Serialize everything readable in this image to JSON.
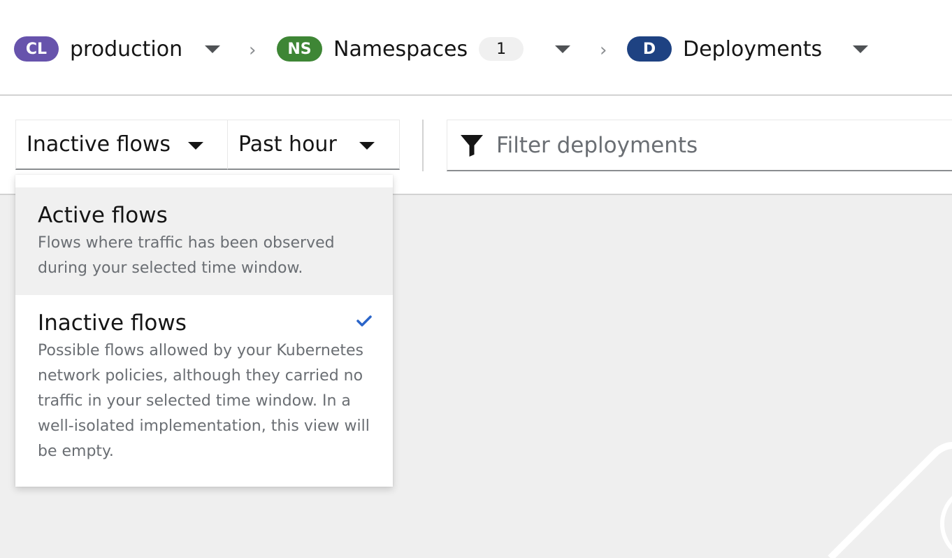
{
  "breadcrumb": {
    "cluster": {
      "badge": "CL",
      "label": "production",
      "color": "#6753ac"
    },
    "namespace": {
      "badge": "NS",
      "label": "Namespaces",
      "count": "1",
      "color": "#3e8635"
    },
    "deployment": {
      "badge": "D",
      "label": "Deployments",
      "color": "#1e4282"
    }
  },
  "toolbar": {
    "flow_select": "Inactive flows",
    "time_select": "Past hour",
    "filter_placeholder": "Filter deployments"
  },
  "flow_menu": {
    "items": [
      {
        "title": "Active flows",
        "description": "Flows where traffic has been observed during your selected time window.",
        "selected": false
      },
      {
        "title": "Inactive flows",
        "description": "Possible flows allowed by your Kubernetes network policies, although they carried no traffic in your selected time window. In a well-isolated implementation, this view will be empty.",
        "selected": true
      }
    ]
  },
  "colors": {
    "check": "#2b65c9",
    "canvas": "#efefef"
  }
}
